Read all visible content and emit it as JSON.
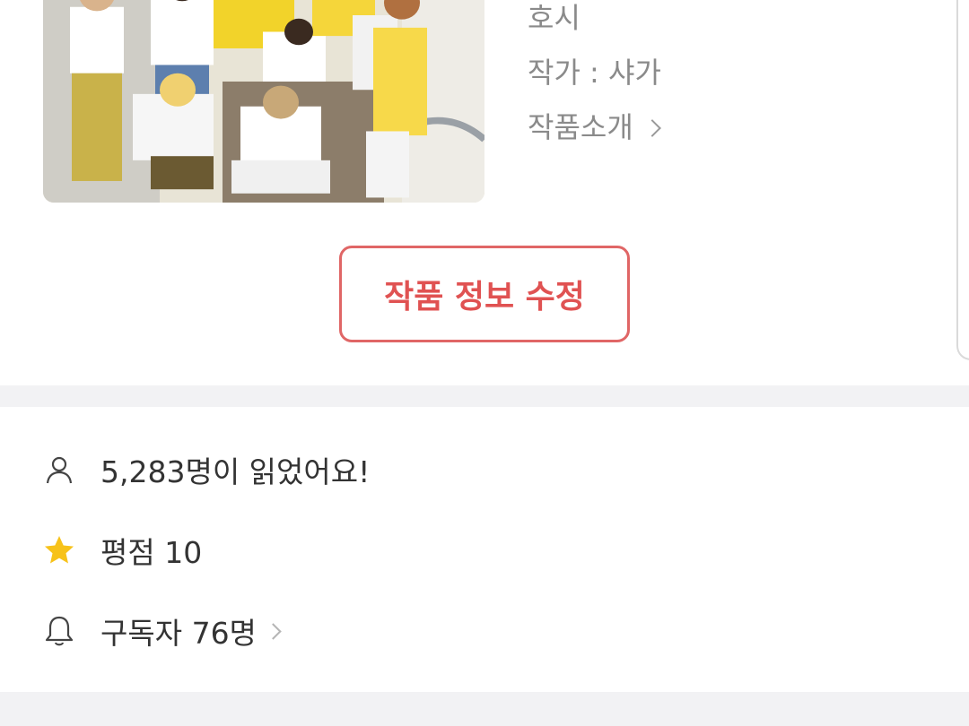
{
  "work": {
    "title": "호시",
    "author": "작가 : 샤가",
    "intro_link": "작품소개",
    "cover_image": "group-photo"
  },
  "edit_button": {
    "label": "작품 정보 수정"
  },
  "stats": {
    "reads": {
      "icon": "person-icon",
      "text": "5,283명이 읽었어요!"
    },
    "rating": {
      "icon": "star-icon",
      "text": "평점 10"
    },
    "subscribers": {
      "icon": "bell-icon",
      "text": "구독자 76명"
    }
  },
  "colors": {
    "accent": "#e05252",
    "star": "#f7c21a",
    "divider": "#f2f2f4",
    "meta_text": "#8a8a8a",
    "body_text": "#333333"
  }
}
